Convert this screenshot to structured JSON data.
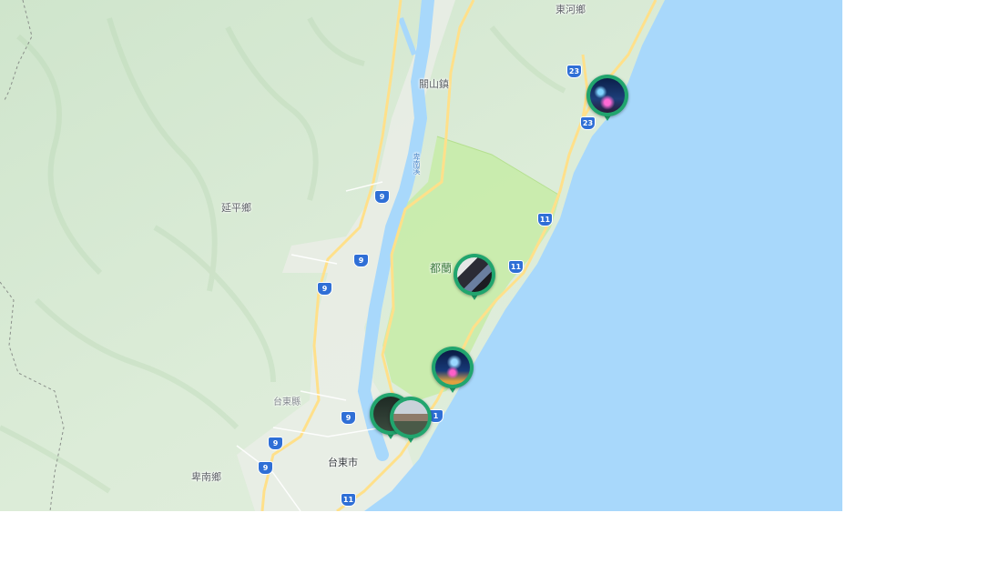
{
  "map": {
    "places": {
      "donghe": "東河鄉",
      "guanshan": "關山鎮",
      "yanping": "延平鄉",
      "dulan": "都蘭",
      "taitung_county": "台東縣",
      "taitung_city": "台東市",
      "beinan": "卑南鄉"
    },
    "river_label": "卑南溪",
    "highway_numbers": {
      "h23_a": "23",
      "h23_b": "23",
      "h9_a": "9",
      "h9_b": "9",
      "h9_c": "9",
      "h9_d": "9",
      "h9_e": "9",
      "h9_f": "9",
      "h11_a": "11",
      "h11_b": "11",
      "h11_c": "1",
      "h11_d": "11"
    },
    "markers": [
      {
        "name": "concert-night",
        "photo": "night-stage"
      },
      {
        "name": "festival-crowd",
        "photo": "crowd"
      },
      {
        "name": "light-show",
        "photo": "night-stage"
      },
      {
        "name": "stage-cluster",
        "photo": "outdoor-stage"
      }
    ],
    "colors": {
      "sea": "#a8d8fb",
      "land": "#dff0dc",
      "park": "#c8ecac",
      "marker": "#21a56e",
      "road": "#ffe08a",
      "highway_shield": "#2f6fd6"
    }
  }
}
